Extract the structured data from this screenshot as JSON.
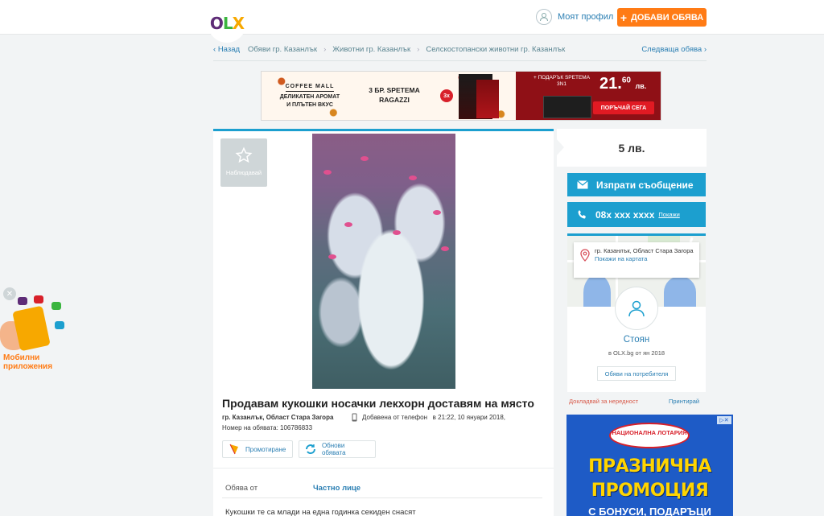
{
  "header": {
    "logo": {
      "o": "O",
      "l": "L",
      "x": "X"
    },
    "profile_label": "Моят профил",
    "add_label": "ДОБАВИ ОБЯВА",
    "add_icon": "+"
  },
  "breadcrumbs": {
    "back": "Назад",
    "items": [
      "Обяви гр. Казанлък",
      "Животни гр. Казанлък",
      "Селскостопански животни гр. Казанлък"
    ],
    "next": "Следваща обява"
  },
  "banner": {
    "brand_tag": "COFFEE MALL",
    "brand_text": "ДЕЛИКАТЕН АРОМАТ И ПЛЪТЕН ВКУС",
    "offer": "3 БР. SPETEMA RAGAZZI",
    "badge": "3x",
    "gift": "+ ПОДАРЪК SPETEMA 3N1",
    "price_main": "21.",
    "price_cents": "60",
    "price_unit": "лв.",
    "cta": "ПОРЪЧАЙ СЕГА"
  },
  "listing": {
    "watch_label": "Наблюдавай",
    "title": "Продавам кукошки носачки лекхорн доставям на място",
    "location": "гр. Казанлък, Област Стара Загора",
    "added": "Добавена от телефон",
    "added_time": "в 21:22, 10 януари 2018,",
    "ad_number": "Номер на обявата: 106786833",
    "promote": "Промотиране",
    "refresh": "Обнови обявата",
    "offer_from_label": "Обява от",
    "offer_from_value": "Частно лице",
    "description": "Кукошки те са млади на една годинка секиден снасят"
  },
  "sidebar": {
    "price": "5 лв.",
    "message": "Изпрати съобщение",
    "phone": "08x xxx xxxx",
    "phone_show": "Покажи",
    "location": "гр. Казанлък, Област Стара Загора",
    "show_map": "Покажи на картата",
    "user_name": "Стоян",
    "user_since": "в OLX.bg от ян 2018",
    "user_ads": "Обяви на потребителя",
    "report": "Докладвай за нередност",
    "print": "Принтирай"
  },
  "lotto": {
    "brand": "НАЦИОНАЛНА ЛОТАРИЯ",
    "line1": "ПРАЗНИЧНА",
    "line2": "ПРОМОЦИЯ",
    "line3": "С БОНУСИ, ПОДАРЪЦИ",
    "close": "▷✕"
  },
  "apps": {
    "label": "Мобилни приложения",
    "close": "✕"
  },
  "colors": {
    "accent": "#1c9fcf",
    "orange": "#ff7b15",
    "link": "#2b7fb3"
  }
}
